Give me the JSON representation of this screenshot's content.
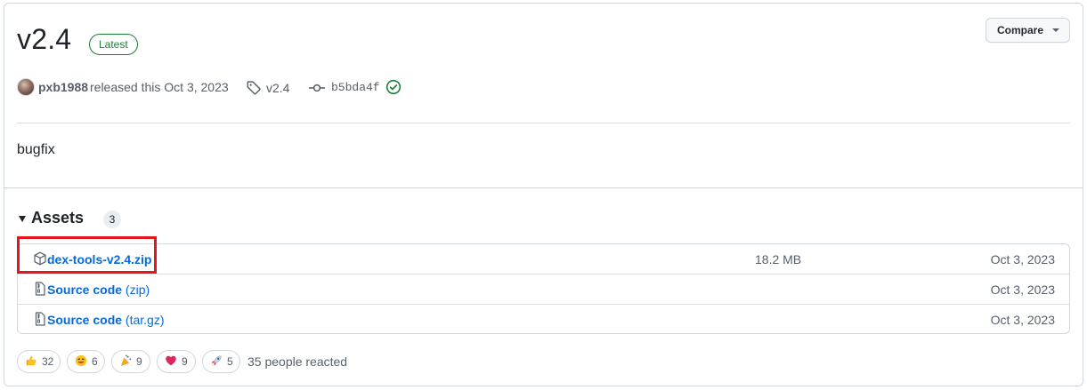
{
  "release": {
    "title": "v2.4",
    "badge": "Latest",
    "compare_label": "Compare",
    "author": "pxb1988",
    "released_text": "released this Oct 3, 2023",
    "tag": "v2.4",
    "commit": "b5bda4f",
    "body": "bugfix"
  },
  "assets": {
    "title": "Assets",
    "count": "3",
    "items": [
      {
        "name": "dex-tools-v2.4.zip",
        "ext": "",
        "size": "18.2 MB",
        "date": "Oct 3, 2023",
        "icon": "package-icon"
      },
      {
        "name": "Source code",
        "ext": "(zip)",
        "size": "",
        "date": "Oct 3, 2023",
        "icon": "file-zip-icon"
      },
      {
        "name": "Source code",
        "ext": "(tar.gz)",
        "size": "",
        "date": "Oct 3, 2023",
        "icon": "file-zip-icon"
      }
    ]
  },
  "reactions": {
    "items": [
      {
        "emoji": "thumbs-up",
        "count": "32"
      },
      {
        "emoji": "smile",
        "count": "6"
      },
      {
        "emoji": "tada",
        "count": "9"
      },
      {
        "emoji": "heart",
        "count": "9"
      },
      {
        "emoji": "rocket",
        "count": "5"
      }
    ],
    "summary": "35 people reacted"
  },
  "colors": {
    "link": "#0969da",
    "badge_green": "#1a7f37",
    "highlight": "#e8141c"
  }
}
